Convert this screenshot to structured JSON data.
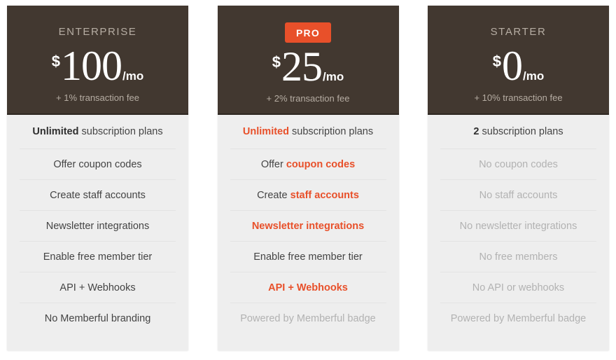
{
  "theme": {
    "header_bg": "#423830",
    "card_bg": "#eeeeee",
    "accent": "#e8502a",
    "text": "#444444",
    "muted": "#b2b2b2",
    "header_label": "#b6ada3"
  },
  "plans": [
    {
      "name": "ENTERPRISE",
      "name_is_badge": false,
      "currency": "$",
      "amount": "100",
      "period": "/mo",
      "fee_note": "+ 1% transaction fee",
      "features": [
        {
          "lead": "Unlimited",
          "lead_style": "bold",
          "rest": " subscription plans",
          "style": "normal"
        },
        {
          "lead": "",
          "lead_style": "none",
          "rest": "Offer coupon codes",
          "style": "normal"
        },
        {
          "lead": "",
          "lead_style": "none",
          "rest": "Create staff accounts",
          "style": "normal"
        },
        {
          "lead": "",
          "lead_style": "none",
          "rest": "Newsletter integrations",
          "style": "normal"
        },
        {
          "lead": "",
          "lead_style": "none",
          "rest": "Enable free member tier",
          "style": "normal"
        },
        {
          "lead": "",
          "lead_style": "none",
          "rest": "API + Webhooks",
          "style": "normal"
        },
        {
          "lead": "",
          "lead_style": "none",
          "rest": "No Memberful branding",
          "style": "normal"
        }
      ]
    },
    {
      "name": "PRO",
      "name_is_badge": true,
      "currency": "$",
      "amount": "25",
      "period": "/mo",
      "fee_note": "+ 2% transaction fee",
      "features": [
        {
          "lead": "Unlimited",
          "lead_style": "accent",
          "rest": " subscription plans",
          "style": "normal"
        },
        {
          "lead": "",
          "lead_style": "none",
          "rest": "Offer ",
          "accent_tail": "coupon codes",
          "style": "normal"
        },
        {
          "lead": "",
          "lead_style": "none",
          "rest": "Create ",
          "accent_tail": "staff accounts",
          "style": "normal"
        },
        {
          "lead": "",
          "lead_style": "none",
          "rest": "Newsletter integrations",
          "style": "accent-all"
        },
        {
          "lead": "",
          "lead_style": "none",
          "rest": "Enable free member tier",
          "style": "normal"
        },
        {
          "lead": "",
          "lead_style": "none",
          "rest": "API + Webhooks",
          "style": "accent-all"
        },
        {
          "lead": "",
          "lead_style": "none",
          "rest": "Powered by Memberful badge",
          "style": "muted"
        }
      ]
    },
    {
      "name": "STARTER",
      "name_is_badge": false,
      "currency": "$",
      "amount": "0",
      "period": "/mo",
      "fee_note": "+ 10% transaction fee",
      "features": [
        {
          "lead": "2",
          "lead_style": "bold",
          "rest": " subscription plans",
          "style": "normal"
        },
        {
          "lead": "",
          "lead_style": "none",
          "rest": "No coupon codes",
          "style": "muted"
        },
        {
          "lead": "",
          "lead_style": "none",
          "rest": "No staff accounts",
          "style": "muted"
        },
        {
          "lead": "",
          "lead_style": "none",
          "rest": "No newsletter integrations",
          "style": "muted"
        },
        {
          "lead": "",
          "lead_style": "none",
          "rest": "No free members",
          "style": "muted"
        },
        {
          "lead": "",
          "lead_style": "none",
          "rest": "No API or webhooks",
          "style": "muted"
        },
        {
          "lead": "",
          "lead_style": "none",
          "rest": "Powered by Memberful badge",
          "style": "muted"
        }
      ]
    }
  ]
}
